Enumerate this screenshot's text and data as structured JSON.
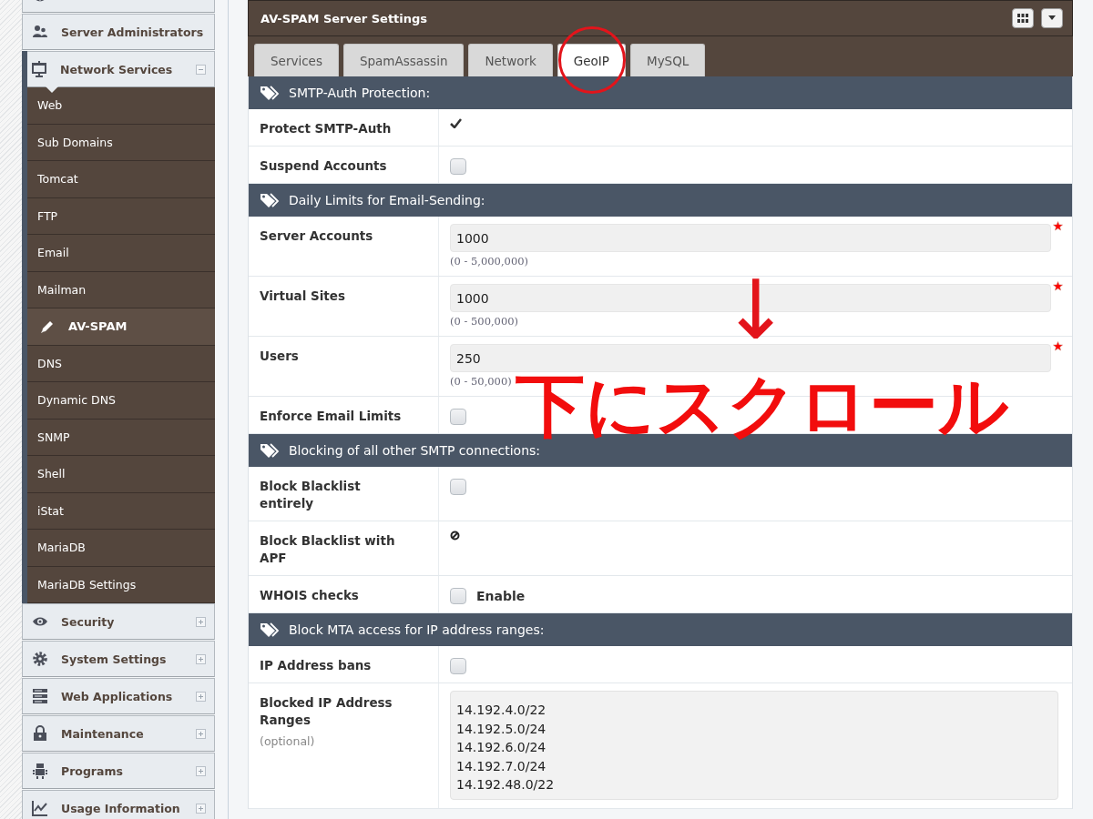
{
  "sidebar": {
    "items": [
      {
        "kind": "link"
      },
      {
        "label": "Server Administrators",
        "kind": "link"
      },
      {
        "label": "Network Services",
        "kind": "group",
        "expanded": true,
        "children": [
          {
            "label": "Web",
            "selected": false
          },
          {
            "label": "Sub Domains",
            "selected": false
          },
          {
            "label": "Tomcat",
            "selected": false
          },
          {
            "label": "FTP",
            "selected": false
          },
          {
            "label": "Email",
            "selected": false
          },
          {
            "label": "Mailman",
            "selected": false
          },
          {
            "label": "AV-SPAM",
            "selected": true
          },
          {
            "label": "DNS",
            "selected": false
          },
          {
            "label": "Dynamic DNS",
            "selected": false
          },
          {
            "label": "SNMP",
            "selected": false
          },
          {
            "label": "Shell",
            "selected": false
          },
          {
            "label": "iStat",
            "selected": false
          },
          {
            "label": "MariaDB",
            "selected": false
          },
          {
            "label": "MariaDB Settings",
            "selected": false
          }
        ]
      },
      {
        "label": "Security",
        "kind": "group",
        "expanded": false
      },
      {
        "label": "System Settings",
        "kind": "group",
        "expanded": false
      },
      {
        "label": "Web Applications",
        "kind": "group",
        "expanded": false
      },
      {
        "label": "Maintenance",
        "kind": "group",
        "expanded": false
      },
      {
        "label": "Programs",
        "kind": "group",
        "expanded": false
      },
      {
        "label": "Usage Information",
        "kind": "group",
        "expanded": false
      }
    ]
  },
  "panel": {
    "title": "AV-SPAM Server Settings",
    "tabs": [
      {
        "label": "Services",
        "selected": false
      },
      {
        "label": "SpamAssassin",
        "selected": false
      },
      {
        "label": "Network",
        "selected": false
      },
      {
        "label": "GeoIP",
        "selected": true
      },
      {
        "label": "MySQL",
        "selected": false
      }
    ],
    "sections": [
      {
        "title": "SMTP-Auth Protection:",
        "rows": [
          {
            "label": "Protect SMTP-Auth",
            "kind": "status",
            "checked": true
          },
          {
            "label": "Suspend Accounts",
            "kind": "checkbox",
            "checked": false
          }
        ]
      },
      {
        "title": "Daily Limits for Email-Sending:",
        "rows": [
          {
            "label": "Server Accounts",
            "kind": "number",
            "value": "1000",
            "hint": "(0 - 5,000,000)",
            "required": true
          },
          {
            "label": "Virtual Sites",
            "kind": "number",
            "value": "1000",
            "hint": "(0 - 500,000)",
            "required": true
          },
          {
            "label": "Users",
            "kind": "number",
            "value": "250",
            "hint": "(0 - 50,000)",
            "required": true
          },
          {
            "label": "Enforce Email Limits",
            "kind": "checkbox",
            "checked": false
          }
        ]
      },
      {
        "title": "Blocking of all other SMTP connections:",
        "rows": [
          {
            "label": "Block Blacklist entirely",
            "kind": "checkbox",
            "checked": false
          },
          {
            "label": "Block Blacklist with APF",
            "kind": "status",
            "checked": false
          },
          {
            "label": "WHOIS checks",
            "kind": "checkbox",
            "checked": false,
            "option": "Enable"
          }
        ]
      },
      {
        "title": "Block MTA access for IP address ranges:",
        "rows": [
          {
            "label": "IP Address bans",
            "kind": "checkbox",
            "checked": false
          },
          {
            "label": "Blocked IP Address Ranges",
            "note": "(optional)",
            "kind": "textarea",
            "lines": [
              "14.192.4.0/22",
              "14.192.5.0/24",
              "14.192.6.0/24",
              "14.192.7.0/24",
              "14.192.48.0/22"
            ]
          }
        ]
      }
    ]
  },
  "annotation": {
    "arrow": "↓",
    "text": "下にスクロール"
  }
}
